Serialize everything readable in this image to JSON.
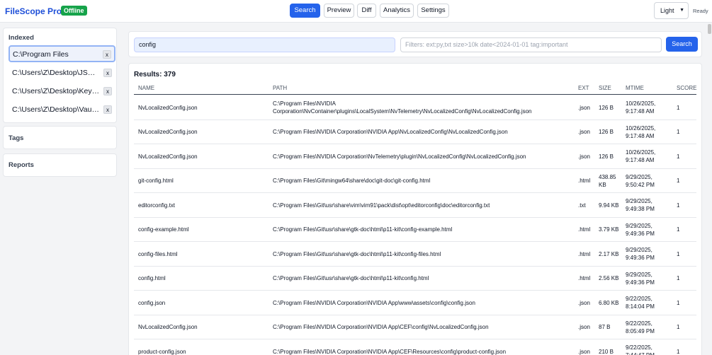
{
  "app": {
    "title": "FileScope Pro+",
    "status_badge": "Offline",
    "ready": "Ready"
  },
  "nav": [
    {
      "label": "Search",
      "active": true
    },
    {
      "label": "Preview",
      "active": false
    },
    {
      "label": "Diff",
      "active": false
    },
    {
      "label": "Analytics",
      "active": false
    },
    {
      "label": "Settings",
      "active": false
    }
  ],
  "theme": {
    "selected": "Light"
  },
  "sidebar": {
    "indexed_title": "Indexed",
    "indexed": [
      {
        "path": "C:\\Program Files",
        "remove": "x"
      },
      {
        "path": "C:\\Users\\Z\\Desktop\\JSON...",
        "remove": "x"
      },
      {
        "path": "C:\\Users\\Z\\Desktop\\KeyM...",
        "remove": "x"
      },
      {
        "path": "C:\\Users\\Z\\Desktop\\VaultS...",
        "remove": "x"
      }
    ],
    "tags_title": "Tags",
    "reports_title": "Reports"
  },
  "search": {
    "query": "config",
    "filters_placeholder": "Filters: ext:py,txt size>10k date<2024-01-01 tag:important",
    "button": "Search"
  },
  "results": {
    "title": "Results: 379",
    "columns": [
      "NAME",
      "PATH",
      "EXT",
      "SIZE",
      "MTIME",
      "SCORE"
    ],
    "rows": [
      {
        "name": "NvLocalizedConfig.json",
        "path": "C:\\Program Files\\NVIDIA Corporation\\NvContainer\\plugins\\LocalSystem\\NvTelemetry\\NvLocalizedConfig\\NvLocalizedConfig.json",
        "ext": ".json",
        "size": "126 B",
        "mtime": "10/26/2025, 9:17:48 AM",
        "score": "1"
      },
      {
        "name": "NvLocalizedConfig.json",
        "path": "C:\\Program Files\\NVIDIA Corporation\\NVIDIA App\\NvLocalizedConfig\\NvLocalizedConfig.json",
        "ext": ".json",
        "size": "126 B",
        "mtime": "10/26/2025, 9:17:48 AM",
        "score": "1"
      },
      {
        "name": "NvLocalizedConfig.json",
        "path": "C:\\Program Files\\NVIDIA Corporation\\NvTelemetry\\plugin\\NvLocalizedConfig\\NvLocalizedConfig.json",
        "ext": ".json",
        "size": "126 B",
        "mtime": "10/26/2025, 9:17:48 AM",
        "score": "1"
      },
      {
        "name": "git-config.html",
        "path": "C:\\Program Files\\Git\\mingw64\\share\\doc\\git-doc\\git-config.html",
        "ext": ".html",
        "size": "438.85 KB",
        "mtime": "9/29/2025, 9:50:42 PM",
        "score": "1"
      },
      {
        "name": "editorconfig.txt",
        "path": "C:\\Program Files\\Git\\usr\\share\\vim\\vim91\\pack\\dist\\opt\\editorconfig\\doc\\editorconfig.txt",
        "ext": ".txt",
        "size": "9.94 KB",
        "mtime": "9/29/2025, 9:49:38 PM",
        "score": "1"
      },
      {
        "name": "config-example.html",
        "path": "C:\\Program Files\\Git\\usr\\share\\gtk-doc\\html\\p11-kit\\config-example.html",
        "ext": ".html",
        "size": "3.79 KB",
        "mtime": "9/29/2025, 9:49:36 PM",
        "score": "1"
      },
      {
        "name": "config-files.html",
        "path": "C:\\Program Files\\Git\\usr\\share\\gtk-doc\\html\\p11-kit\\config-files.html",
        "ext": ".html",
        "size": "2.17 KB",
        "mtime": "9/29/2025, 9:49:36 PM",
        "score": "1"
      },
      {
        "name": "config.html",
        "path": "C:\\Program Files\\Git\\usr\\share\\gtk-doc\\html\\p11-kit\\config.html",
        "ext": ".html",
        "size": "2.56 KB",
        "mtime": "9/29/2025, 9:49:36 PM",
        "score": "1"
      },
      {
        "name": "config.json",
        "path": "C:\\Program Files\\NVIDIA Corporation\\NVIDIA App\\www\\assets\\config\\config.json",
        "ext": ".json",
        "size": "6.80 KB",
        "mtime": "9/22/2025, 8:14:04 PM",
        "score": "1"
      },
      {
        "name": "NvLocalizedConfig.json",
        "path": "C:\\Program Files\\NVIDIA Corporation\\NVIDIA App\\CEF\\config\\NvLocalizedConfig.json",
        "ext": ".json",
        "size": "87 B",
        "mtime": "9/22/2025, 8:05:49 PM",
        "score": "1"
      },
      {
        "name": "product-config.json",
        "path": "C:\\Program Files\\NVIDIA Corporation\\NVIDIA App\\CEF\\Resources\\config\\product-config.json",
        "ext": ".json",
        "size": "210 B",
        "mtime": "9/22/2025, 7:44:47 PM",
        "score": "1"
      }
    ]
  },
  "colors": {
    "accent": "#2563eb",
    "offline_badge": "#16a34a",
    "brand": "#1d4ed8"
  }
}
